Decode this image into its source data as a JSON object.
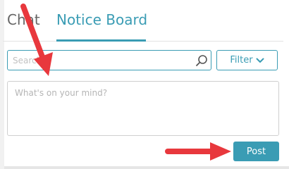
{
  "tabs": [
    {
      "label": "Chat",
      "active": false
    },
    {
      "label": "Notice Board",
      "active": true
    }
  ],
  "search": {
    "placeholder": "Search",
    "icon": "search-icon"
  },
  "filter": {
    "label": "Filter",
    "icon": "chevron-down-icon"
  },
  "composer": {
    "placeholder": "What's on your mind?"
  },
  "post": {
    "label": "Post"
  },
  "colors": {
    "accent": "#3a9cb4",
    "annotation_arrow": "#e8383d"
  }
}
